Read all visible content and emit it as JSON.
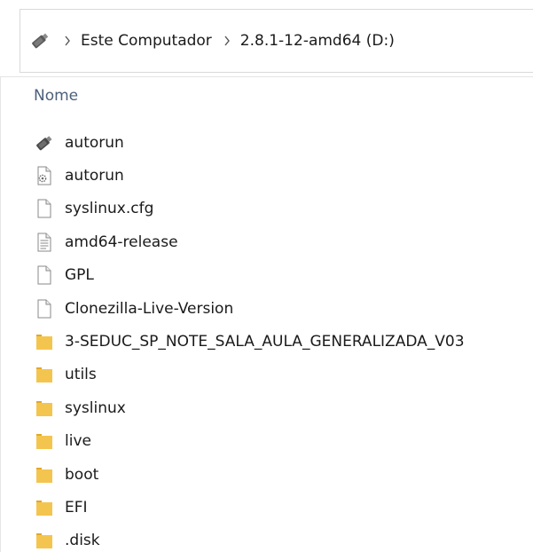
{
  "address_bar": {
    "drive_icon": "usb-drive-icon",
    "separator_icon": "chevron-right-icon",
    "breadcrumbs": [
      "Este Computador",
      "2.8.1-12-amd64 (D:)"
    ]
  },
  "columns": {
    "name_header": "Nome"
  },
  "files": [
    {
      "name": "autorun",
      "icon": "usb-drive-icon"
    },
    {
      "name": "autorun",
      "icon": "settings-file-icon"
    },
    {
      "name": "syslinux.cfg",
      "icon": "blank-file-icon"
    },
    {
      "name": "amd64-release",
      "icon": "text-file-icon"
    },
    {
      "name": "GPL",
      "icon": "blank-file-icon"
    },
    {
      "name": "Clonezilla-Live-Version",
      "icon": "blank-file-icon"
    },
    {
      "name": "3-SEDUC_SP_NOTE_SALA_AULA_GENERALIZADA_V03",
      "icon": "folder-icon"
    },
    {
      "name": "utils",
      "icon": "folder-icon"
    },
    {
      "name": "syslinux",
      "icon": "folder-icon"
    },
    {
      "name": "live",
      "icon": "folder-icon"
    },
    {
      "name": "boot",
      "icon": "folder-icon"
    },
    {
      "name": "EFI",
      "icon": "folder-icon"
    },
    {
      "name": ".disk",
      "icon": "folder-icon"
    }
  ],
  "colors": {
    "folder": "#f4c54e",
    "folder_dark": "#e2a82a",
    "header_text": "#4c607a"
  }
}
